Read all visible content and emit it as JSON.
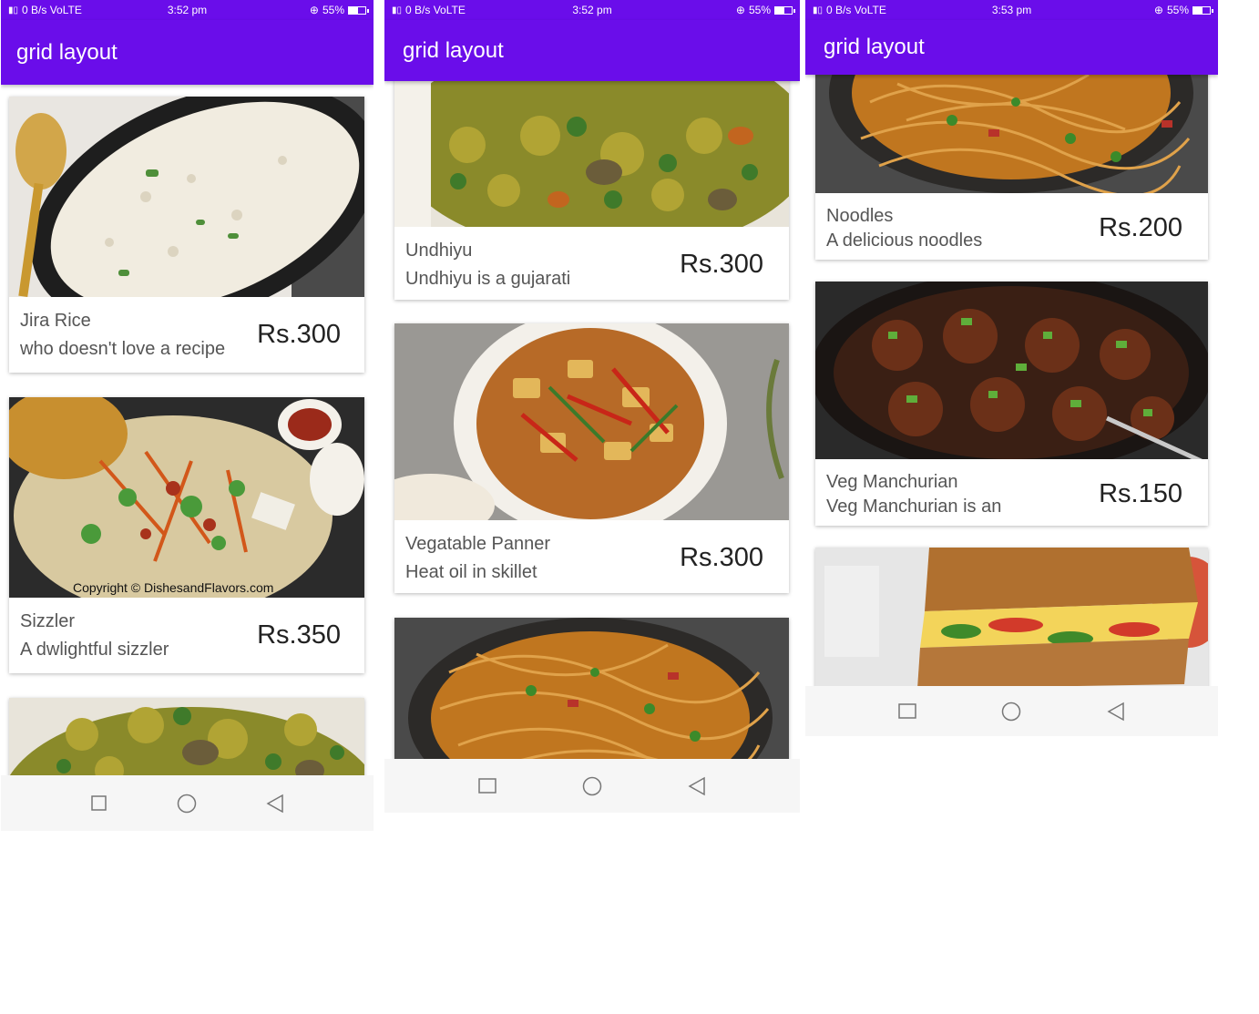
{
  "app_title": "grid layout",
  "phones": [
    {
      "status": {
        "network": "0 B/s VoLTE",
        "time": "3:52 pm",
        "battery": "55%",
        "battery_level": 0.55
      },
      "cards": [
        {
          "name": "Jira Rice",
          "desc": "who doesn't love a recipe",
          "price": "Rs.300",
          "image": "rice-photo"
        },
        {
          "name": "Sizzler",
          "desc": "A dwlightful sizzler",
          "price": "Rs.350",
          "image": "sizzler-photo",
          "watermark": "Copyright © DishesandFlavors.com"
        },
        {
          "name": "",
          "desc": "",
          "price": "",
          "image": "undhiyu-photo"
        }
      ]
    },
    {
      "status": {
        "network": "0 B/s VoLTE",
        "time": "3:52 pm",
        "battery": "55%",
        "battery_level": 0.55
      },
      "cards": [
        {
          "name": "Undhiyu",
          "desc": "Undhiyu is a gujarati",
          "price": "Rs.300",
          "image": "undhiyu-photo"
        },
        {
          "name": "Vegatable Panner",
          "desc": "Heat oil in skillet",
          "price": "Rs.300",
          "image": "paneer-photo"
        },
        {
          "name": "",
          "desc": "",
          "price": "",
          "image": "noodles-photo"
        }
      ]
    },
    {
      "status": {
        "network": "0 B/s VoLTE",
        "time": "3:53 pm",
        "battery": "55%",
        "battery_level": 0.55
      },
      "cards": [
        {
          "name": "Noodles",
          "desc": "A delicious noodles",
          "price": "Rs.200",
          "image": "noodles-photo"
        },
        {
          "name": "Veg Manchurian",
          "desc": "Veg Manchurian is an",
          "price": "Rs.150",
          "image": "manchurian-photo"
        },
        {
          "name": "",
          "desc": "",
          "price": "",
          "image": "sandwich-photo"
        }
      ]
    }
  ],
  "navbar": {
    "icons": [
      "recents-square-icon",
      "home-circle-icon",
      "back-triangle-icon"
    ]
  },
  "colors": {
    "primary": "#6a0dea",
    "card_bg": "#ffffff",
    "nav_bg": "#f6f6f6",
    "text": "#555555"
  }
}
